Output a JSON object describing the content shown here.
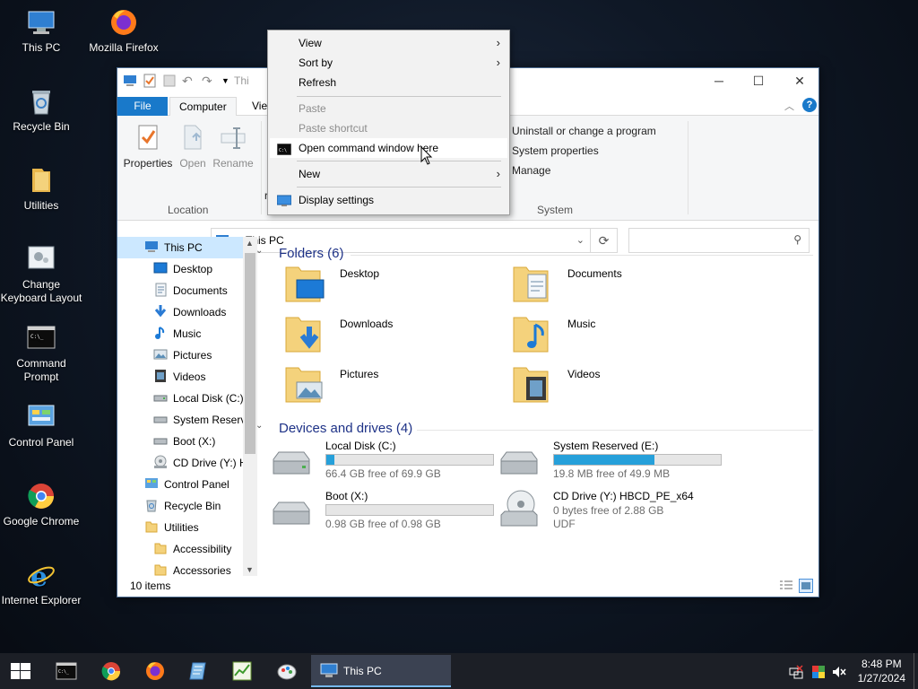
{
  "desktop": {
    "icons": [
      {
        "label": "This PC"
      },
      {
        "label": "Mozilla Firefox"
      },
      {
        "label": "Recycle Bin"
      },
      {
        "label": "Utilities"
      },
      {
        "label": "Change Keyboard Layout"
      },
      {
        "label": "Command Prompt"
      },
      {
        "label": "Control Panel"
      },
      {
        "label": "Google Chrome"
      },
      {
        "label": "Internet Explorer"
      }
    ]
  },
  "window": {
    "title_fragment": "Thi",
    "tabs": {
      "file": "File",
      "computer": "Computer",
      "view": "Vie"
    },
    "ribbon": {
      "properties": "Properties",
      "open": "Open",
      "rename": "Rename",
      "location_group": "Location",
      "system_group": "System",
      "uninstall": "Uninstall or change a program",
      "system_properties": "System properties",
      "manage": "Manage",
      "r_fragment": "r"
    },
    "address": {
      "path": "This PC",
      "search_placeholder": ""
    },
    "nav": [
      {
        "label": "This PC"
      },
      {
        "label": "Desktop"
      },
      {
        "label": "Documents"
      },
      {
        "label": "Downloads"
      },
      {
        "label": "Music"
      },
      {
        "label": "Pictures"
      },
      {
        "label": "Videos"
      },
      {
        "label": "Local Disk (C:)"
      },
      {
        "label": "System Reserve"
      },
      {
        "label": "Boot (X:)"
      },
      {
        "label": "CD Drive (Y:) H"
      },
      {
        "label": "Control Panel"
      },
      {
        "label": "Recycle Bin"
      },
      {
        "label": "Utilities"
      },
      {
        "label": "Accessibility"
      },
      {
        "label": "Accessories"
      }
    ],
    "folders_header": "Folders (6)",
    "folders": [
      {
        "label": "Desktop"
      },
      {
        "label": "Documents"
      },
      {
        "label": "Downloads"
      },
      {
        "label": "Music"
      },
      {
        "label": "Pictures"
      },
      {
        "label": "Videos"
      }
    ],
    "drives_header": "Devices and drives (4)",
    "drives": [
      {
        "name": "Local Disk (C:)",
        "free": "66.4 GB free of 69.9 GB",
        "used_fraction": 0.05
      },
      {
        "name": "System Reserved (E:)",
        "free": "19.8 MB free of 49.9 MB",
        "used_fraction": 0.6
      },
      {
        "name": "Boot (X:)",
        "free": "0.98 GB free of 0.98 GB",
        "used_fraction": 0
      },
      {
        "name": "CD Drive (Y:) HBCD_PE_x64",
        "free": "0 bytes free of 2.88 GB",
        "fs": "UDF"
      }
    ],
    "status": "10 items"
  },
  "context_menu": {
    "items": [
      {
        "label": "View",
        "submenu": true
      },
      {
        "label": "Sort by",
        "submenu": true
      },
      {
        "label": "Refresh"
      },
      {
        "label": "Paste",
        "disabled": true
      },
      {
        "label": "Paste shortcut",
        "disabled": true
      },
      {
        "label": "Open command window here"
      },
      {
        "label": "New",
        "submenu": true
      },
      {
        "label": "Display settings"
      }
    ]
  },
  "taskbar": {
    "active_label": "This PC",
    "time": "8:48 PM",
    "date": "1/27/2024"
  },
  "colors": {
    "accent": "#1979ca",
    "drive_fill": "#26a0da",
    "header_blue": "#1e3287"
  }
}
